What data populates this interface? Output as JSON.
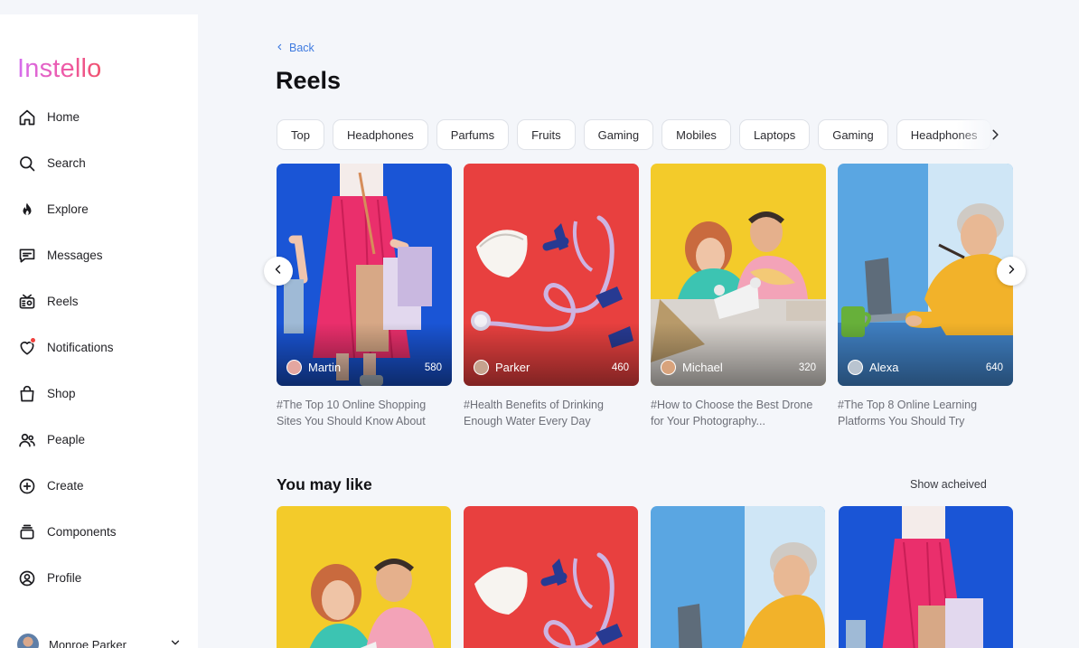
{
  "app": {
    "logo_text": "Instello"
  },
  "sidebar": {
    "items": [
      {
        "label": "Home",
        "icon": "home-icon"
      },
      {
        "label": "Search",
        "icon": "search-icon"
      },
      {
        "label": "Explore",
        "icon": "flame-icon"
      },
      {
        "label": "Messages",
        "icon": "message-icon"
      },
      {
        "label": "Reels",
        "icon": "reels-icon"
      },
      {
        "label": "Notifications",
        "icon": "heart-icon"
      },
      {
        "label": "Shop",
        "icon": "bag-icon"
      },
      {
        "label": "Peaple",
        "icon": "people-icon"
      },
      {
        "label": "Create",
        "icon": "plus-circle-icon"
      },
      {
        "label": "Components",
        "icon": "layers-icon"
      },
      {
        "label": "Profile",
        "icon": "user-circle-icon"
      }
    ],
    "user": {
      "name": "Monroe Parker"
    }
  },
  "header": {
    "back_label": "Back",
    "title": "Reels"
  },
  "chips": [
    "Top",
    "Headphones",
    "Parfums",
    "Fruits",
    "Gaming",
    "Mobiles",
    "Laptops",
    "Gaming",
    "Headphones"
  ],
  "reels": [
    {
      "author": "Martin",
      "count": "580",
      "caption": "#The Top 10 Online Shopping Sites You Should Know About",
      "theme": "shopping"
    },
    {
      "author": "Parker",
      "count": "460",
      "caption": "#Health Benefits of Drinking Enough Water Every Day",
      "theme": "medical"
    },
    {
      "author": "Michael",
      "count": "320",
      "caption": "#How to Choose the Best Drone for Your Photography...",
      "theme": "drone"
    },
    {
      "author": "Alexa",
      "count": "640",
      "caption": "#The Top 8 Online Learning Platforms You Should Try",
      "theme": "learning"
    }
  ],
  "you_may_like": {
    "title": "You may like",
    "link": "Show acheived",
    "items": [
      {
        "theme": "drone"
      },
      {
        "theme": "medical"
      },
      {
        "theme": "learning"
      },
      {
        "theme": "shopping"
      }
    ]
  },
  "colors": {
    "accent": "#3f7be0",
    "background": "#f4f6fa",
    "notification_dot": "#f0413d",
    "logo_gradient": [
      "#d56df0",
      "#ee5aa8",
      "#f0526c"
    ]
  }
}
